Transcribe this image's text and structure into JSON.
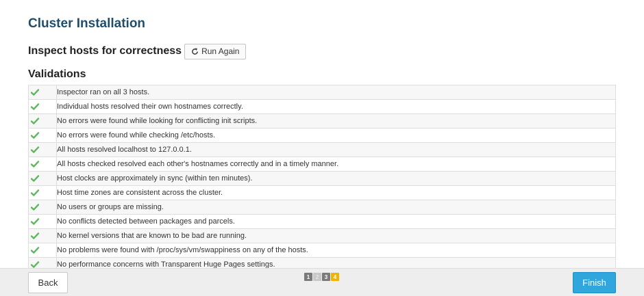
{
  "page": {
    "title": "Cluster Installation",
    "section_title": "Inspect hosts for correctness",
    "run_again_label": "Run Again",
    "validations_title": "Validations"
  },
  "validations": [
    "Inspector ran on all 3 hosts.",
    "Individual hosts resolved their own hostnames correctly.",
    "No errors were found while looking for conflicting init scripts.",
    "No errors were found while checking /etc/hosts.",
    "All hosts resolved localhost to 127.0.0.1.",
    "All hosts checked resolved each other's hostnames correctly and in a timely manner.",
    "Host clocks are approximately in sync (within ten minutes).",
    "Host time zones are consistent across the cluster.",
    "No users or groups are missing.",
    "No conflicts detected between packages and parcels.",
    "No kernel versions that are known to be bad are running.",
    "No problems were found with /proc/sys/vm/swappiness on any of the hosts.",
    "No performance concerns with Transparent Huge Pages settings."
  ],
  "footer": {
    "back_label": "Back",
    "finish_label": "Finish",
    "steps": [
      "1",
      "2",
      "3",
      "4"
    ],
    "current_step": 4
  },
  "colors": {
    "title": "#1f4e6d",
    "check": "#5cb85c",
    "finish": "#2fa7dc",
    "active_step": "#f0b400"
  },
  "icons": {
    "run_again": "refresh-icon",
    "validation_status": "check-icon"
  }
}
